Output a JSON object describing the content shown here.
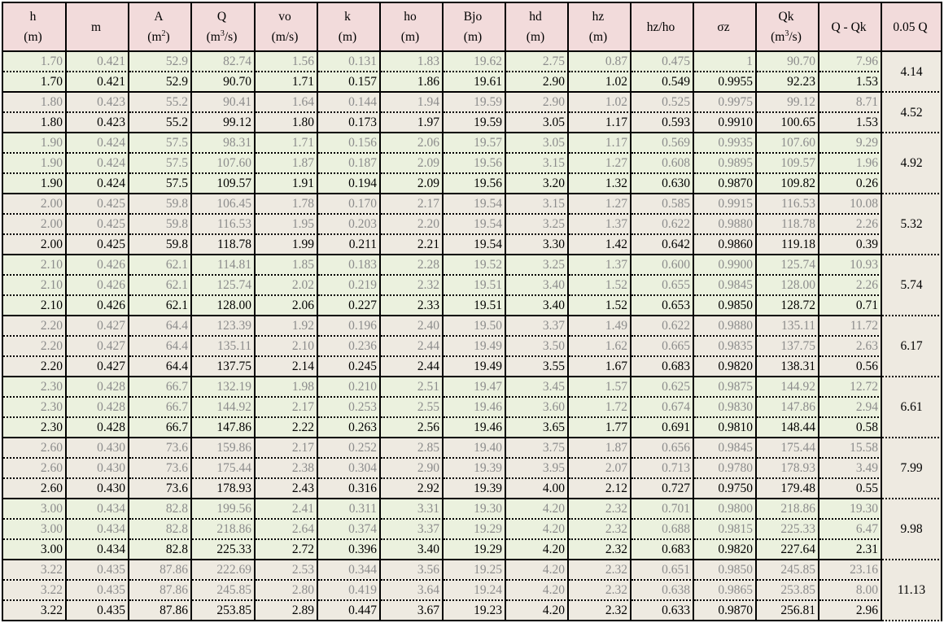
{
  "colors": {
    "header_bg": "#f2dbdb",
    "group_green": "#ebf1de",
    "group_beige": "#eeeae1",
    "faded_text": "#8c8c8c"
  },
  "headers": [
    {
      "label": "h",
      "unit": "(m)"
    },
    {
      "label": "m",
      "unit": ""
    },
    {
      "label": "A",
      "unit_html": "(m<sup>2</sup>)"
    },
    {
      "label": "Q",
      "unit_html": "(m<sup>3</sup>/s)"
    },
    {
      "label": "vo",
      "unit": "(m/s)"
    },
    {
      "label": "k",
      "unit": "(m)"
    },
    {
      "label": "ho",
      "unit": "(m)"
    },
    {
      "label": "Bjo",
      "unit": "(m)"
    },
    {
      "label": "hd",
      "unit": "(m)"
    },
    {
      "label": "hz",
      "unit": "(m)"
    },
    {
      "label": "hz/ho",
      "unit": ""
    },
    {
      "label": "σz",
      "unit": ""
    },
    {
      "label": "Qk",
      "unit_html": "(m<sup>3</sup>/s)"
    },
    {
      "label": "Q - Qk",
      "unit": ""
    },
    {
      "label": "0.05 Q",
      "unit": ""
    }
  ],
  "groups": [
    {
      "bg": "green",
      "tol": "4.14",
      "rows": [
        [
          "1.70",
          "0.421",
          "52.9",
          "82.74",
          "1.56",
          "0.131",
          "1.83",
          "19.62",
          "2.75",
          "0.87",
          "0.475",
          "1",
          "90.70",
          "7.96"
        ],
        [
          "1.70",
          "0.421",
          "52.9",
          "90.70",
          "1.71",
          "0.157",
          "1.86",
          "19.61",
          "2.90",
          "1.02",
          "0.549",
          "0.9955",
          "92.23",
          "1.53"
        ]
      ]
    },
    {
      "bg": "beige",
      "tol": "4.52",
      "rows": [
        [
          "1.80",
          "0.423",
          "55.2",
          "90.41",
          "1.64",
          "0.144",
          "1.94",
          "19.59",
          "2.90",
          "1.02",
          "0.525",
          "0.9975",
          "99.12",
          "8.71"
        ],
        [
          "1.80",
          "0.423",
          "55.2",
          "99.12",
          "1.80",
          "0.173",
          "1.97",
          "19.59",
          "3.05",
          "1.17",
          "0.593",
          "0.9910",
          "100.65",
          "1.53"
        ]
      ]
    },
    {
      "bg": "green",
      "tol": "4.92",
      "rows": [
        [
          "1.90",
          "0.424",
          "57.5",
          "98.31",
          "1.71",
          "0.156",
          "2.06",
          "19.57",
          "3.05",
          "1.17",
          "0.569",
          "0.9935",
          "107.60",
          "9.29"
        ],
        [
          "1.90",
          "0.424",
          "57.5",
          "107.60",
          "1.87",
          "0.187",
          "2.09",
          "19.56",
          "3.15",
          "1.27",
          "0.608",
          "0.9895",
          "109.57",
          "1.96"
        ],
        [
          "1.90",
          "0.424",
          "57.5",
          "109.57",
          "1.91",
          "0.194",
          "2.09",
          "19.56",
          "3.20",
          "1.32",
          "0.630",
          "0.9870",
          "109.82",
          "0.26"
        ]
      ]
    },
    {
      "bg": "beige",
      "tol": "5.32",
      "rows": [
        [
          "2.00",
          "0.425",
          "59.8",
          "106.45",
          "1.78",
          "0.170",
          "2.17",
          "19.54",
          "3.15",
          "1.27",
          "0.585",
          "0.9915",
          "116.53",
          "10.08"
        ],
        [
          "2.00",
          "0.425",
          "59.8",
          "116.53",
          "1.95",
          "0.203",
          "2.20",
          "19.54",
          "3.25",
          "1.37",
          "0.622",
          "0.9880",
          "118.78",
          "2.26"
        ],
        [
          "2.00",
          "0.425",
          "59.8",
          "118.78",
          "1.99",
          "0.211",
          "2.21",
          "19.54",
          "3.30",
          "1.42",
          "0.642",
          "0.9860",
          "119.18",
          "0.39"
        ]
      ]
    },
    {
      "bg": "green",
      "tol": "5.74",
      "rows": [
        [
          "2.10",
          "0.426",
          "62.1",
          "114.81",
          "1.85",
          "0.183",
          "2.28",
          "19.52",
          "3.25",
          "1.37",
          "0.600",
          "0.9900",
          "125.74",
          "10.93"
        ],
        [
          "2.10",
          "0.426",
          "62.1",
          "125.74",
          "2.02",
          "0.219",
          "2.32",
          "19.51",
          "3.40",
          "1.52",
          "0.655",
          "0.9845",
          "128.00",
          "2.26"
        ],
        [
          "2.10",
          "0.426",
          "62.1",
          "128.00",
          "2.06",
          "0.227",
          "2.33",
          "19.51",
          "3.40",
          "1.52",
          "0.653",
          "0.9850",
          "128.72",
          "0.71"
        ]
      ]
    },
    {
      "bg": "beige",
      "tol": "6.17",
      "rows": [
        [
          "2.20",
          "0.427",
          "64.4",
          "123.39",
          "1.92",
          "0.196",
          "2.40",
          "19.50",
          "3.37",
          "1.49",
          "0.622",
          "0.9880",
          "135.11",
          "11.72"
        ],
        [
          "2.20",
          "0.427",
          "64.4",
          "135.11",
          "2.10",
          "0.236",
          "2.44",
          "19.49",
          "3.50",
          "1.62",
          "0.665",
          "0.9835",
          "137.75",
          "2.63"
        ],
        [
          "2.20",
          "0.427",
          "64.4",
          "137.75",
          "2.14",
          "0.245",
          "2.44",
          "19.49",
          "3.55",
          "1.67",
          "0.683",
          "0.9820",
          "138.31",
          "0.56"
        ]
      ]
    },
    {
      "bg": "green",
      "tol": "6.61",
      "rows": [
        [
          "2.30",
          "0.428",
          "66.7",
          "132.19",
          "1.98",
          "0.210",
          "2.51",
          "19.47",
          "3.45",
          "1.57",
          "0.625",
          "0.9875",
          "144.92",
          "12.72"
        ],
        [
          "2.30",
          "0.428",
          "66.7",
          "144.92",
          "2.17",
          "0.253",
          "2.55",
          "19.46",
          "3.60",
          "1.72",
          "0.674",
          "0.9830",
          "147.86",
          "2.94"
        ],
        [
          "2.30",
          "0.428",
          "66.7",
          "147.86",
          "2.22",
          "0.263",
          "2.56",
          "19.46",
          "3.65",
          "1.77",
          "0.691",
          "0.9810",
          "148.44",
          "0.58"
        ]
      ]
    },
    {
      "bg": "beige",
      "tol": "7.99",
      "rows": [
        [
          "2.60",
          "0.430",
          "73.6",
          "159.86",
          "2.17",
          "0.252",
          "2.85",
          "19.40",
          "3.75",
          "1.87",
          "0.656",
          "0.9845",
          "175.44",
          "15.58"
        ],
        [
          "2.60",
          "0.430",
          "73.6",
          "175.44",
          "2.38",
          "0.304",
          "2.90",
          "19.39",
          "3.95",
          "2.07",
          "0.713",
          "0.9780",
          "178.93",
          "3.49"
        ],
        [
          "2.60",
          "0.430",
          "73.6",
          "178.93",
          "2.43",
          "0.316",
          "2.92",
          "19.39",
          "4.00",
          "2.12",
          "0.727",
          "0.9750",
          "179.48",
          "0.55"
        ]
      ]
    },
    {
      "bg": "green",
      "tol": "9.98",
      "rows": [
        [
          "3.00",
          "0.434",
          "82.8",
          "199.56",
          "2.41",
          "0.311",
          "3.31",
          "19.30",
          "4.20",
          "2.32",
          "0.701",
          "0.9800",
          "218.86",
          "19.30"
        ],
        [
          "3.00",
          "0.434",
          "82.8",
          "218.86",
          "2.64",
          "0.374",
          "3.37",
          "19.29",
          "4.20",
          "2.32",
          "0.688",
          "0.9815",
          "225.33",
          "6.47"
        ],
        [
          "3.00",
          "0.434",
          "82.8",
          "225.33",
          "2.72",
          "0.396",
          "3.40",
          "19.29",
          "4.20",
          "2.32",
          "0.683",
          "0.9820",
          "227.64",
          "2.31"
        ]
      ]
    },
    {
      "bg": "beige",
      "tol": "11.13",
      "rows": [
        [
          "3.22",
          "0.435",
          "87.86",
          "222.69",
          "2.53",
          "0.344",
          "3.56",
          "19.25",
          "4.20",
          "2.32",
          "0.651",
          "0.9850",
          "245.85",
          "23.16"
        ],
        [
          "3.22",
          "0.435",
          "87.86",
          "245.85",
          "2.80",
          "0.419",
          "3.64",
          "19.24",
          "4.20",
          "2.32",
          "0.638",
          "0.9865",
          "253.85",
          "8.00"
        ],
        [
          "3.22",
          "0.435",
          "87.86",
          "253.85",
          "2.89",
          "0.447",
          "3.67",
          "19.23",
          "4.20",
          "2.32",
          "0.633",
          "0.9870",
          "256.81",
          "2.96"
        ]
      ]
    }
  ]
}
